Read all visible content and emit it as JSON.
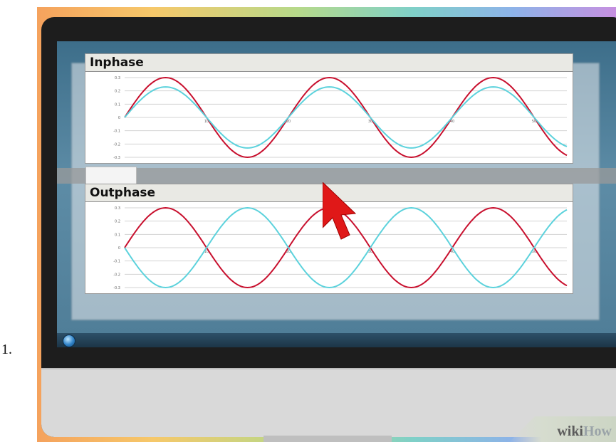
{
  "list_marker": "1.",
  "panels": [
    {
      "title": "Inphase",
      "chart_data": {
        "type": "line",
        "title": "Inphase",
        "x_tick_labels": [
          "10",
          "20",
          "30",
          "40",
          "50"
        ],
        "y_tick_labels": [
          "0.3",
          "0.2",
          "0.1",
          "0",
          "-0.1",
          "-0.2",
          "-0.3"
        ],
        "ylim": [
          -0.3,
          0.3
        ],
        "xlim": [
          0,
          54
        ],
        "grid": true,
        "series": [
          {
            "color": "#c8102e",
            "amplitude": 0.3,
            "phase_deg": 0,
            "period": 20
          },
          {
            "color": "#5cd2dc",
            "amplitude": 0.23,
            "phase_deg": 0,
            "period": 20
          }
        ]
      }
    },
    {
      "title": "Outphase",
      "chart_data": {
        "type": "line",
        "title": "Outphase",
        "x_tick_labels": [
          "10",
          "20",
          "30",
          "40",
          "50"
        ],
        "y_tick_labels": [
          "0.3",
          "0.2",
          "0.1",
          "0",
          "-0.1",
          "-0.2",
          "-0.3"
        ],
        "ylim": [
          -0.3,
          0.3
        ],
        "xlim": [
          0,
          54
        ],
        "grid": true,
        "series": [
          {
            "color": "#c8102e",
            "amplitude": 0.3,
            "phase_deg": 0,
            "period": 20
          },
          {
            "color": "#5cd2dc",
            "amplitude": 0.3,
            "phase_deg": 180,
            "period": 20
          }
        ]
      }
    }
  ],
  "colors": {
    "curve_red": "#c8102e",
    "curve_cyan": "#5cd2dc",
    "cursor": "#e01818"
  },
  "icons": {
    "cursor": "mouse-pointer-arrow",
    "start": "windows-start-orb"
  },
  "watermark": {
    "part1": "wiki",
    "part2": "How"
  }
}
